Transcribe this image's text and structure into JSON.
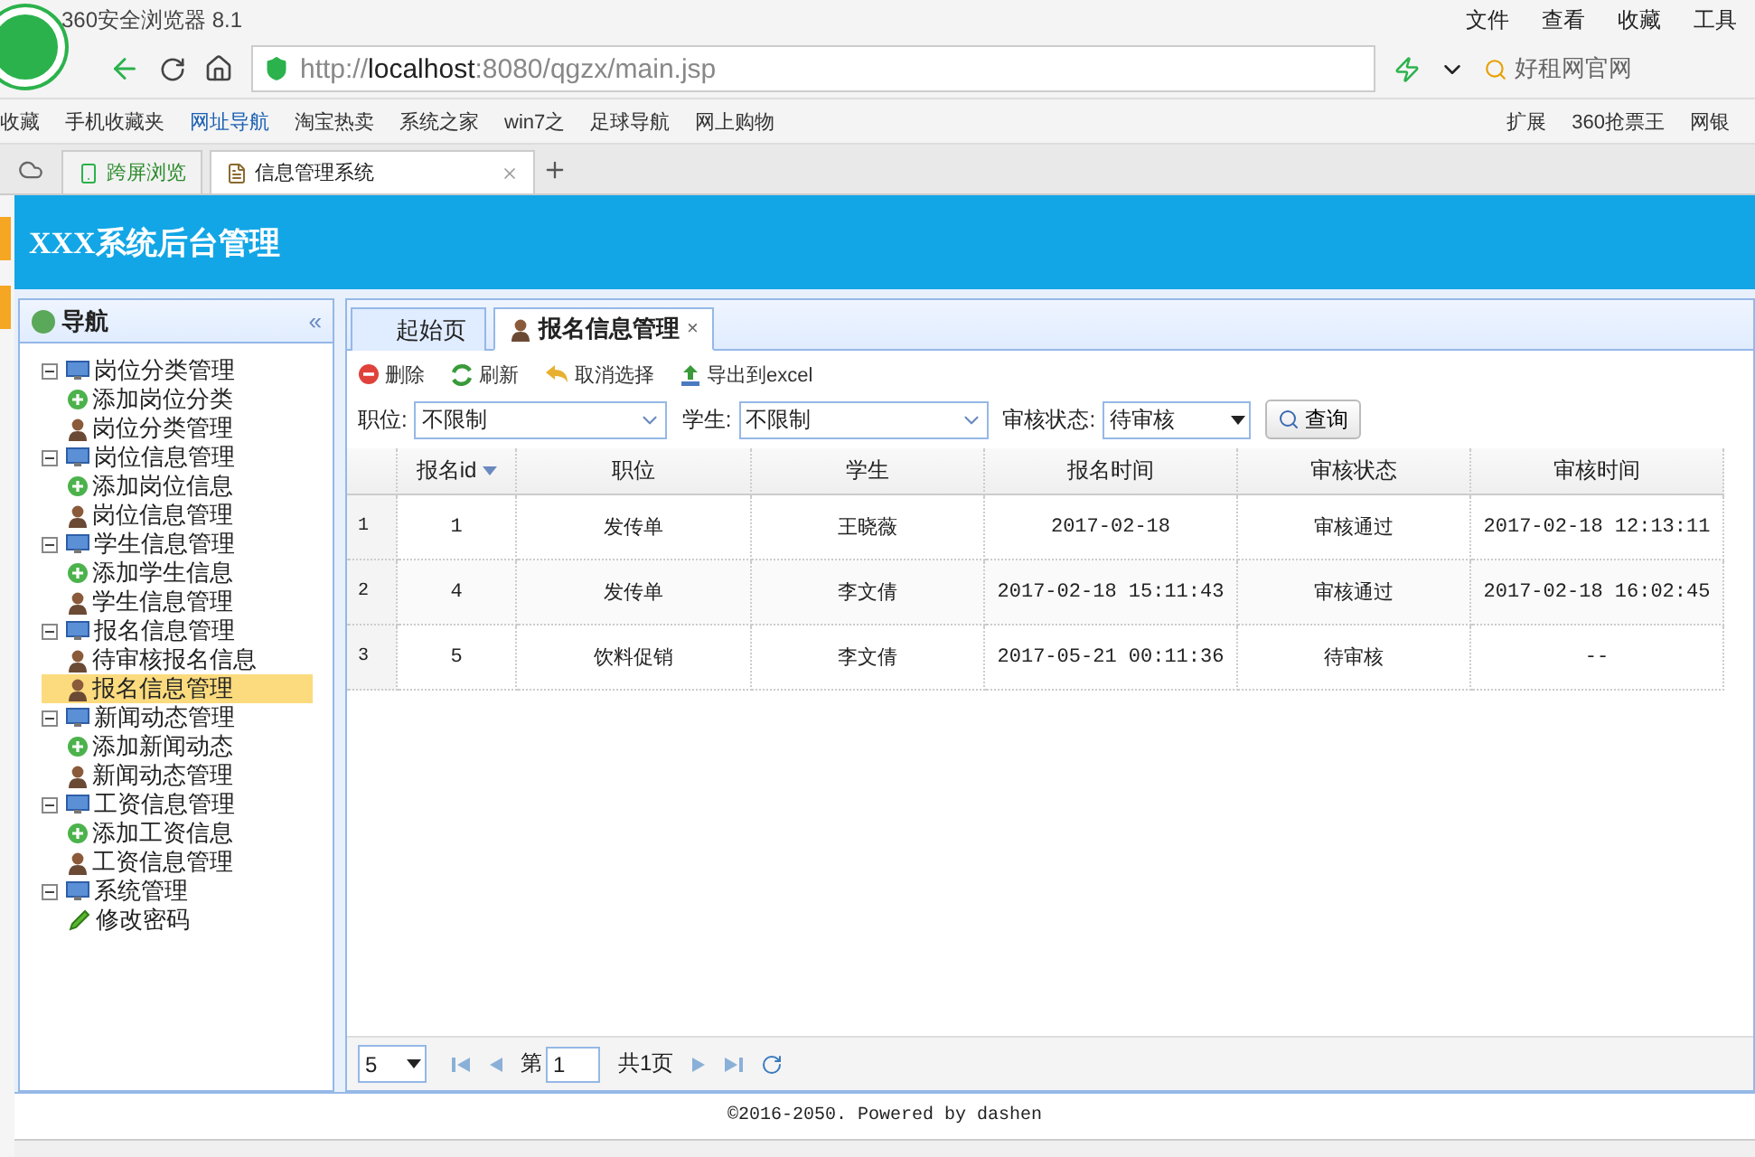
{
  "browser": {
    "title": "360安全浏览器 8.1",
    "menu": [
      "文件",
      "查看",
      "收藏",
      "工具"
    ],
    "url": {
      "scheme": "http://",
      "host": "localhost",
      "rest": ":8080/qgzx/main.jsp"
    },
    "search": "好租网官网",
    "favorites": "收藏",
    "bookmarks": [
      "手机收藏夹",
      "网址导航",
      "淘宝热卖",
      "系统之家",
      "win7之",
      "足球导航",
      "网上购物"
    ],
    "extensions": [
      "扩展",
      "360抢票王",
      "网银"
    ],
    "tabs": [
      {
        "label": "跨屏浏览",
        "selected": false
      },
      {
        "label": "信息管理系统",
        "selected": true
      }
    ]
  },
  "app": {
    "title": "XXX系统后台管理",
    "nav": {
      "title": "导航",
      "collapse": "«",
      "groups": [
        {
          "label": "岗位分类管理",
          "expanded": true,
          "children": [
            {
              "label": "添加岗位分类",
              "kind": "add",
              "selected": false
            },
            {
              "label": "岗位分类管理",
              "kind": "user",
              "selected": false
            }
          ]
        },
        {
          "label": "岗位信息管理",
          "expanded": true,
          "children": [
            {
              "label": "添加岗位信息",
              "kind": "add",
              "selected": false
            },
            {
              "label": "岗位信息管理",
              "kind": "user",
              "selected": false
            }
          ]
        },
        {
          "label": "学生信息管理",
          "expanded": true,
          "children": [
            {
              "label": "添加学生信息",
              "kind": "add",
              "selected": false
            },
            {
              "label": "学生信息管理",
              "kind": "user",
              "selected": false
            }
          ]
        },
        {
          "label": "报名信息管理",
          "expanded": true,
          "children": [
            {
              "label": "待审核报名信息",
              "kind": "user",
              "selected": false
            },
            {
              "label": "报名信息管理",
              "kind": "user",
              "selected": true
            }
          ]
        },
        {
          "label": "新闻动态管理",
          "expanded": true,
          "children": [
            {
              "label": "添加新闻动态",
              "kind": "add",
              "selected": false
            },
            {
              "label": "新闻动态管理",
              "kind": "user",
              "selected": false
            }
          ]
        },
        {
          "label": "工资信息管理",
          "expanded": true,
          "children": [
            {
              "label": "添加工资信息",
              "kind": "add",
              "selected": false
            },
            {
              "label": "工资信息管理",
              "kind": "user",
              "selected": false
            }
          ]
        },
        {
          "label": "系统管理",
          "expanded": true,
          "children": [
            {
              "label": "修改密码",
              "kind": "edit",
              "selected": false
            }
          ]
        }
      ]
    },
    "tabs": [
      {
        "label": "起始页",
        "selected": false,
        "closable": false
      },
      {
        "label": "报名信息管理",
        "selected": true,
        "closable": true,
        "close": "×"
      }
    ],
    "toolbar": [
      {
        "label": "删除",
        "kind": "delete"
      },
      {
        "label": "刷新",
        "kind": "refresh"
      },
      {
        "label": "取消选择",
        "kind": "undo"
      },
      {
        "label": "导出到excel",
        "kind": "export"
      }
    ],
    "filters": [
      {
        "label": "职位:",
        "value": "不限制",
        "kind": "combo"
      },
      {
        "label": "学生:",
        "value": "不限制",
        "kind": "combo"
      },
      {
        "label": "审核状态:",
        "value": "待审核",
        "kind": "select"
      }
    ],
    "query": "查询",
    "table": {
      "columns": [
        {
          "label": "报名id",
          "sorted": true
        },
        {
          "label": "职位",
          "sorted": false
        },
        {
          "label": "学生",
          "sorted": false
        },
        {
          "label": "报名时间",
          "sorted": false
        },
        {
          "label": "审核状态",
          "sorted": false
        },
        {
          "label": "审核时间",
          "sorted": false
        }
      ],
      "rows": [
        {
          "number": "1",
          "cells": [
            "1",
            "发传单",
            "王晓薇",
            "2017-02-18",
            "审核通过",
            "2017-02-18 12:13:11"
          ]
        },
        {
          "number": "2",
          "cells": [
            "4",
            "发传单",
            "李文倩",
            "2017-02-18 15:11:43",
            "审核通过",
            "2017-02-18 16:02:45"
          ]
        },
        {
          "number": "3",
          "cells": [
            "5",
            "饮料促销",
            "李文倩",
            "2017-05-21 00:11:36",
            "待审核",
            "--"
          ]
        }
      ]
    },
    "pager": {
      "size": "5",
      "page_label": "第",
      "page": "1",
      "total": "共1页"
    },
    "footer": "©2016-2050. Powered by dashen"
  }
}
